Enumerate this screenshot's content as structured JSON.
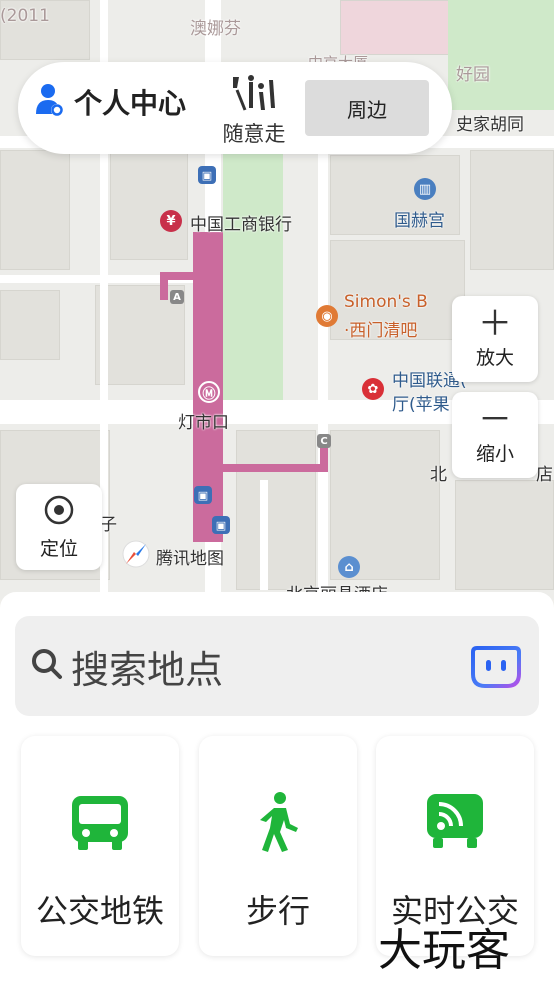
{
  "top_bar": {
    "user_label": "个人中心",
    "walk_label": "随意走",
    "nearby_label": "周边"
  },
  "map": {
    "labels": {
      "bank": "中国工商银行",
      "guohegong": "国赫宫",
      "shijiahutong": "史家胡同",
      "haoyuan": "好园",
      "aonafen": "澳娜芬",
      "simons": "Simon's B",
      "ximen": "·西门清吧",
      "unicom1": "中国联通(",
      "unicom2": "厅(苹果",
      "dengshikou": "灯市口",
      "bei": "北",
      "dian": "店",
      "zi": "子",
      "hotel": "北京丽晶酒店",
      "top_left": "(2011",
      "top_mid": "中京大厦",
      "metro_a": "A",
      "metro_c": "C"
    },
    "zoom_in_label": "放大",
    "zoom_out_label": "缩小",
    "locate_label": "定位",
    "brand": "腾讯地图",
    "colors": {
      "metro": "#cb6b9d",
      "green": "#cfe9c9",
      "brand_blue": "#1b6bf0"
    }
  },
  "search": {
    "placeholder": "搜索地点",
    "icon": "search-icon"
  },
  "cards": [
    {
      "label": "公交地铁",
      "icon": "bus-icon"
    },
    {
      "label": "步行",
      "icon": "walk-icon"
    },
    {
      "label": "实时公交",
      "icon": "realtime-bus-icon"
    }
  ],
  "watermark": "大玩客",
  "accent_green": "#1fb53a"
}
